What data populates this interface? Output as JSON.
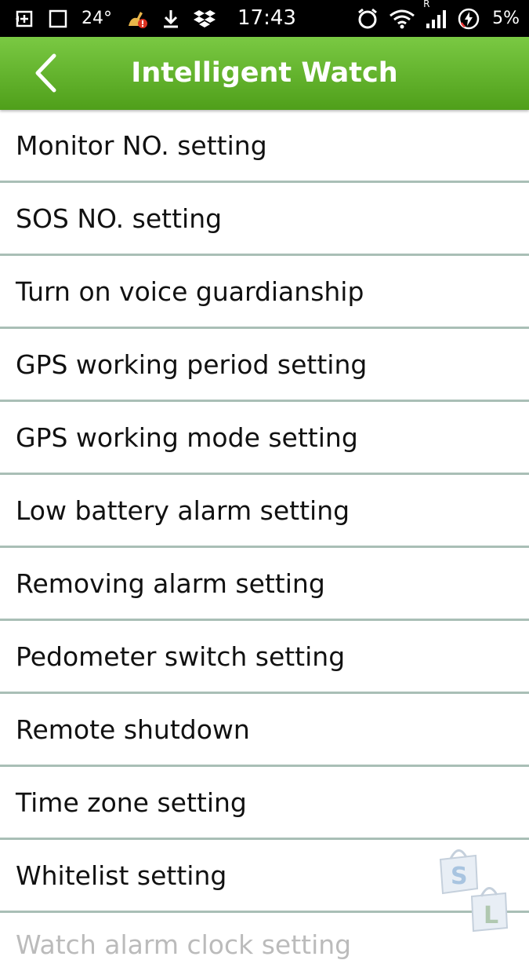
{
  "status_bar": {
    "temperature": "24°",
    "time": "17:43",
    "network_indicator": "R",
    "battery_percent": "5%",
    "icons": [
      "add-box-icon",
      "square-icon",
      "cleaner-alert-icon",
      "download-icon",
      "dropbox-icon",
      "alarm-icon",
      "wifi-icon",
      "signal-icon",
      "battery-charging-icon"
    ]
  },
  "app_bar": {
    "title": "Intelligent Watch",
    "back_icon": "chevron-left-icon",
    "color": "#5fb02a"
  },
  "menu": {
    "items": [
      {
        "label": "Monitor NO. setting"
      },
      {
        "label": "SOS NO. setting"
      },
      {
        "label": "Turn on voice guardianship"
      },
      {
        "label": "GPS working period setting"
      },
      {
        "label": "GPS working mode setting"
      },
      {
        "label": "Low battery alarm setting"
      },
      {
        "label": "Removing alarm setting"
      },
      {
        "label": "Pedometer switch setting"
      },
      {
        "label": "Remote shutdown"
      },
      {
        "label": "Time zone setting"
      },
      {
        "label": "Whitelist setting"
      },
      {
        "label": "Watch alarm clock setting"
      }
    ]
  },
  "watermark": {
    "letters": [
      "S",
      "L"
    ]
  }
}
